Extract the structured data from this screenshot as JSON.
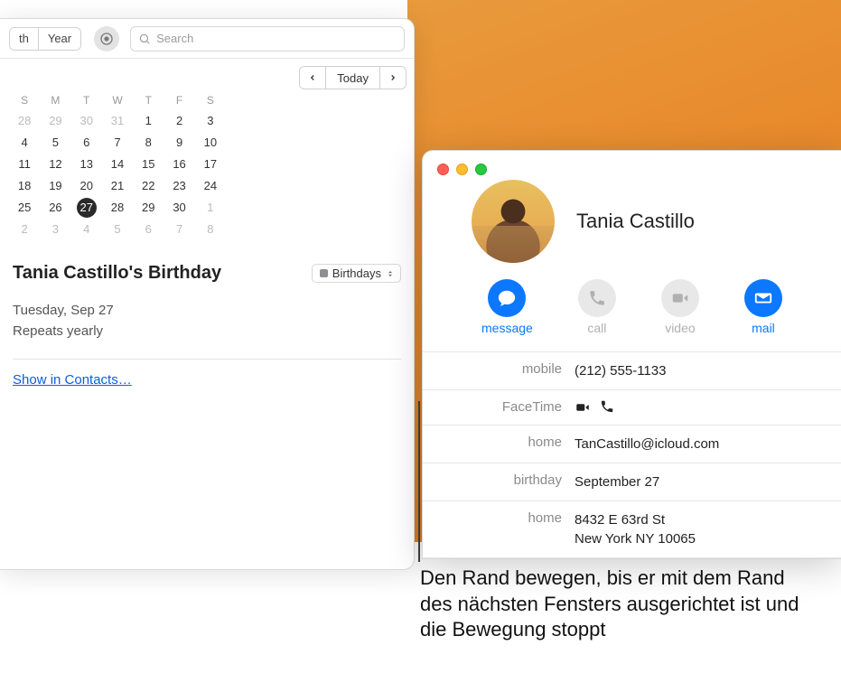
{
  "calendar": {
    "toolbar": {
      "view_left": "th",
      "view_right": "Year",
      "search_placeholder": "Search"
    },
    "nav": {
      "today_label": "Today"
    },
    "mini": {
      "dow": [
        "S",
        "M",
        "T",
        "W",
        "T",
        "F",
        "S"
      ],
      "weeks": [
        [
          "28",
          "29",
          "30",
          "31",
          "1",
          "2",
          "3"
        ],
        [
          "4",
          "5",
          "6",
          "7",
          "8",
          "9",
          "10"
        ],
        [
          "11",
          "12",
          "13",
          "14",
          "15",
          "16",
          "17"
        ],
        [
          "18",
          "19",
          "20",
          "21",
          "22",
          "23",
          "24"
        ],
        [
          "25",
          "26",
          "27",
          "28",
          "29",
          "30",
          "1"
        ],
        [
          "2",
          "3",
          "4",
          "5",
          "6",
          "7",
          "8"
        ]
      ],
      "other_rows": {
        "0": [
          0,
          1,
          2,
          3
        ],
        "4": [
          6
        ],
        "5": [
          0,
          1,
          2,
          3,
          4,
          5,
          6
        ]
      },
      "today": [
        4,
        2
      ]
    },
    "event": {
      "title": "Tania Castillo's Birthday",
      "cal_select": "Birthdays",
      "date": "Tuesday, Sep 27",
      "repeat": "Repeats yearly",
      "show_link": "Show in Contacts…"
    }
  },
  "contact": {
    "name": "Tania Castillo",
    "actions": {
      "message": "message",
      "call": "call",
      "video": "video",
      "mail": "mail"
    },
    "fields": {
      "mobile_k": "mobile",
      "mobile_v": "(212) 555-1133",
      "facetime_k": "FaceTime",
      "homeemail_k": "home",
      "homeemail_v": "TanCastillo@icloud.com",
      "birthday_k": "birthday",
      "birthday_v": "September 27",
      "homeaddr_k": "home",
      "homeaddr_v": "8432 E 63rd St\nNew York NY 10065"
    }
  },
  "callout": "Den Rand bewegen, bis er mit dem Rand des nächsten Fensters ausgerichtet ist und die Bewegung stoppt"
}
